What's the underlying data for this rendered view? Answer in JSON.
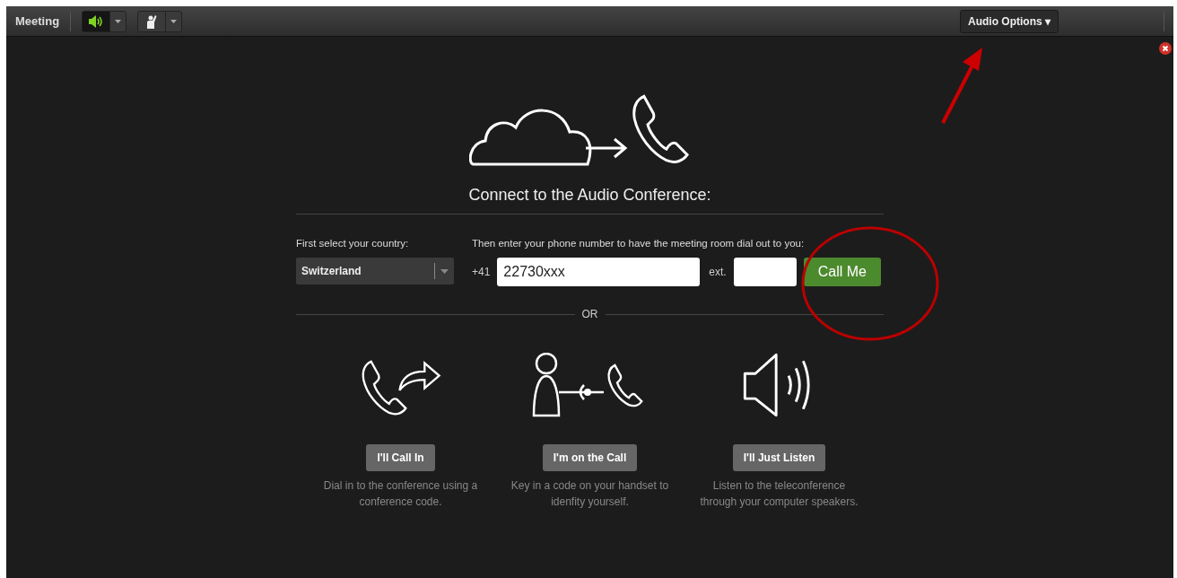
{
  "toolbar": {
    "title": "Meeting",
    "buttons": [
      {
        "kind": "speaker",
        "selected": true
      },
      {
        "kind": "hand",
        "selected": false
      }
    ],
    "audio_options": "Audio Options ▾"
  },
  "dialog": {
    "heading": "Connect to the Audio Conference:",
    "country_label": "First select your country:",
    "country": "Switzerland",
    "phone_label": "Then enter your phone number to have the meeting room dial out to you:",
    "prefix": "+41",
    "phone": "22730xxx",
    "ext_label": "ext.",
    "call_button": "Call Me",
    "or": "OR",
    "options": [
      {
        "kind": "call-in",
        "button": "I'll Call In",
        "text": "Dial in to the conference using a conference code."
      },
      {
        "kind": "on-call",
        "button": "I'm on the Call",
        "text": "Key in a code on your handset to idenfity yourself."
      },
      {
        "kind": "listen",
        "button": "I'll Just Listen",
        "text": "Listen to the teleconference through your computer speakers."
      }
    ]
  }
}
